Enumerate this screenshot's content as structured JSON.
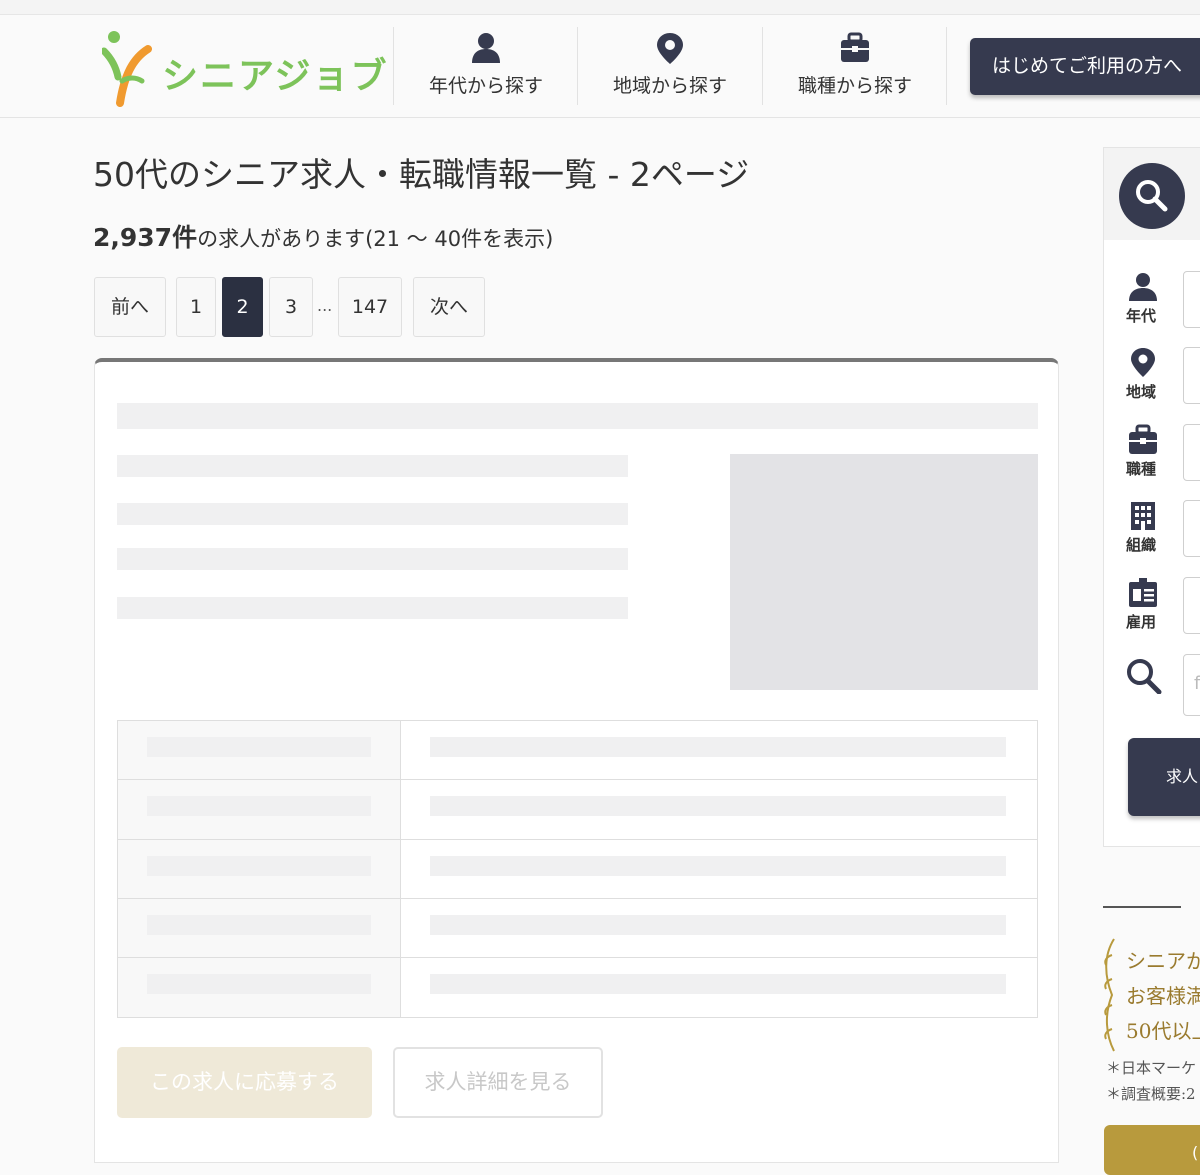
{
  "breadcrumb": "",
  "header": {
    "logo_text": "シニアジョブ",
    "nav": [
      {
        "label": "年代から探す",
        "icon": "person-icon"
      },
      {
        "label": "地域から探す",
        "icon": "map-pin-icon"
      },
      {
        "label": "職種から探す",
        "icon": "briefcase-icon"
      }
    ],
    "first_time_button": "はじめてご利用の方へ",
    "accent": "#363a4f",
    "logo_green": "#7dc35a",
    "logo_orange": "#f09a2f"
  },
  "page": {
    "title": "50代のシニア求人・転職情報一覧 - 2ページ",
    "count_number": "2,937件",
    "count_suffix": "の求人があります(21 〜 40件を表示)"
  },
  "pagination": {
    "prev": "前へ",
    "pages": [
      "1",
      "2",
      "3"
    ],
    "active": "2",
    "ellipsis": "...",
    "last": "147",
    "next": "次へ"
  },
  "job_card": {
    "apply_label": "この求人に応募する",
    "detail_label": "求人詳細を見る"
  },
  "sidebar": {
    "filters": [
      {
        "label": "年代",
        "icon": "person-icon"
      },
      {
        "label": "地域",
        "icon": "map-pin-icon"
      },
      {
        "label": "職種",
        "icon": "briefcase-icon"
      },
      {
        "label": "組織",
        "icon": "building-icon"
      },
      {
        "label": "雇用",
        "icon": "id-card-icon"
      }
    ],
    "keyword_placeholder": "f",
    "search_button": "求人"
  },
  "promo": {
    "lines": [
      "シニアか",
      "お客様満",
      "50代以上"
    ],
    "notes": [
      "＊日本マーケ",
      "＊調査概要:2"
    ],
    "button_label": "("
  }
}
